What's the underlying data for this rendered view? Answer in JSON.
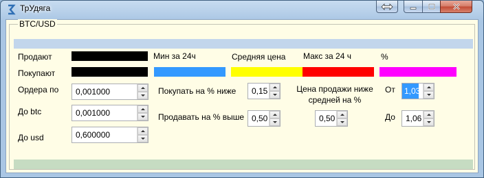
{
  "window": {
    "title": "ТрУдяга"
  },
  "group": {
    "title": "BTC/USD"
  },
  "labels": {
    "sell": "Продают",
    "buy": "Покупают",
    "min24": "Мин за 24ч",
    "avg": "Средняя цена",
    "max24": "Макс за 24 ч",
    "percent": "%",
    "orders_by": "Ордера по",
    "to_btc": "До btc",
    "to_usd": "До usd",
    "buy_lower": "Покупать на % ниже",
    "sell_higher": "Продавать на % выше",
    "sell_price_line1": "Цена продажи ниже",
    "sell_price_line2": "средней на %",
    "from": "От",
    "to": "До"
  },
  "colors": {
    "sell_bar": "#000000",
    "buy_bar": "#000000",
    "min24": "#3399ff",
    "avg": "#ffff00",
    "max24": "#ff0000",
    "percent": "#ff00ff"
  },
  "fields": {
    "orders_by": "0,001000",
    "to_btc": "0,001000",
    "to_usd": "0,600000",
    "buy_lower": "0,15",
    "sell_higher": "0,50",
    "sell_price_below_avg": "0,50",
    "from": "1,03",
    "to": "1,06"
  },
  "icons": {
    "app": "app-icon",
    "special": "double-arrow-icon",
    "minimize": "minimize-icon",
    "maximize": "maximize-icon",
    "close": "close-icon"
  }
}
